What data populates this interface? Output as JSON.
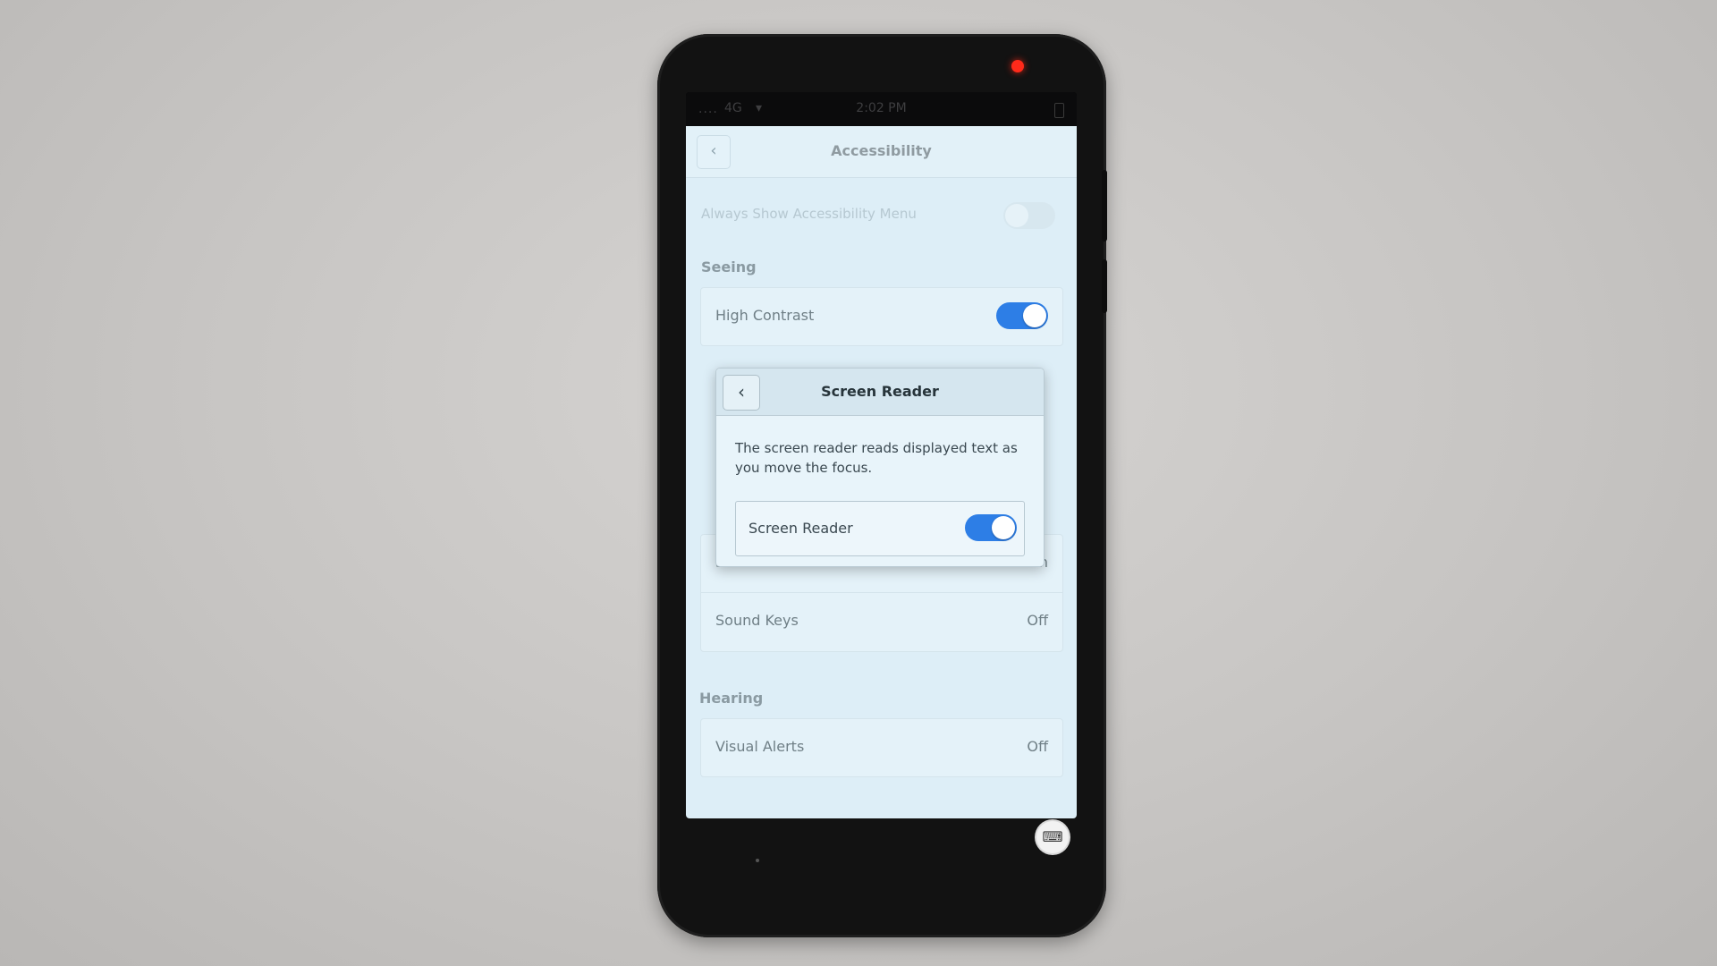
{
  "statusbar": {
    "signal": "....",
    "network": "4G",
    "wifi": "▾",
    "time": "2:02 PM"
  },
  "header": {
    "back_icon": "‹",
    "title": "Accessibility"
  },
  "menu_toggle": {
    "label": "Always Show Accessibility Menu",
    "state": "off"
  },
  "sections": {
    "seeing": {
      "label": "Seeing",
      "high_contrast_label": "High Contrast",
      "high_contrast_state": "on",
      "screen_reader_label": "Screen Reader",
      "screen_reader_value": "On",
      "sound_keys_label": "Sound Keys",
      "sound_keys_value": "Off"
    },
    "hearing": {
      "label": "Hearing",
      "visual_alerts_label": "Visual Alerts",
      "visual_alerts_value": "Off"
    }
  },
  "dialog": {
    "back_icon": "‹",
    "title": "Screen Reader",
    "description": "The screen reader reads displayed text as you move the focus.",
    "toggle_label": "Screen Reader",
    "toggle_state": "on"
  },
  "keyboard_button_icon": "⌨",
  "colors": {
    "accent": "#2d7ee6",
    "led": "#ff2a1a"
  }
}
